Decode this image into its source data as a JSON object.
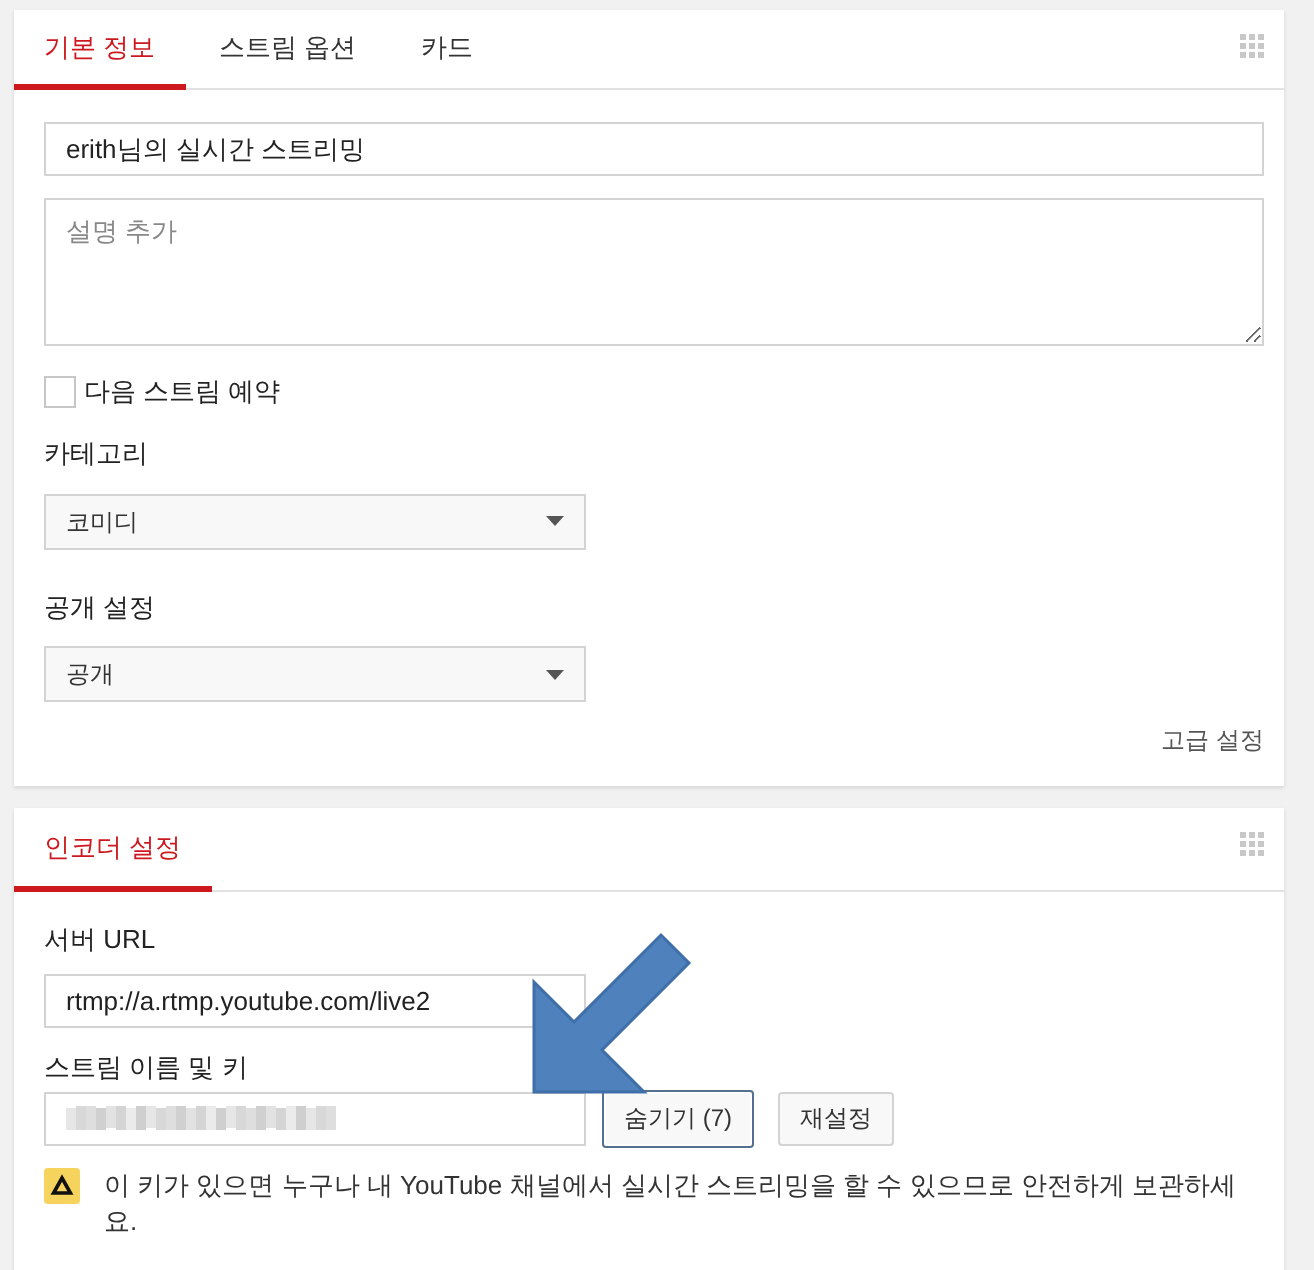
{
  "basic_card": {
    "tabs": [
      {
        "label": "기본 정보",
        "selected": true
      },
      {
        "label": "스트림 옵션",
        "selected": false
      },
      {
        "label": "카드",
        "selected": false
      }
    ],
    "title_field": {
      "value": "erith님의 실시간 스트리밍"
    },
    "description_field": {
      "placeholder": "설명 추가"
    },
    "schedule_checkbox": {
      "label": "다음 스트림 예약",
      "checked": false
    },
    "dropdowns": [
      {
        "label": "카테고리",
        "value": "코미디"
      },
      {
        "label": "공개 설정",
        "value": "공개"
      }
    ],
    "advanced_link": "고급 설정"
  },
  "encoder_card": {
    "tabs": [
      {
        "label": "인코더 설정",
        "selected": true
      }
    ],
    "server_url": {
      "label": "서버 URL",
      "value": "rtmp://a.rtmp.youtube.com/live2"
    },
    "stream_key": {
      "label": "스트림 이름 및 키",
      "redacted": true
    },
    "buttons": [
      {
        "label": "숨기기 (7)",
        "focused": true
      },
      {
        "label": "재설정",
        "focused": false
      }
    ],
    "warning": "이 키가 있으면 누구나 내 YouTube 채널에서 실시간 스트리밍을 할 수 있으므로 안전하게 보관하세요."
  },
  "annotations": [
    {
      "kind": "arrow"
    }
  ]
}
